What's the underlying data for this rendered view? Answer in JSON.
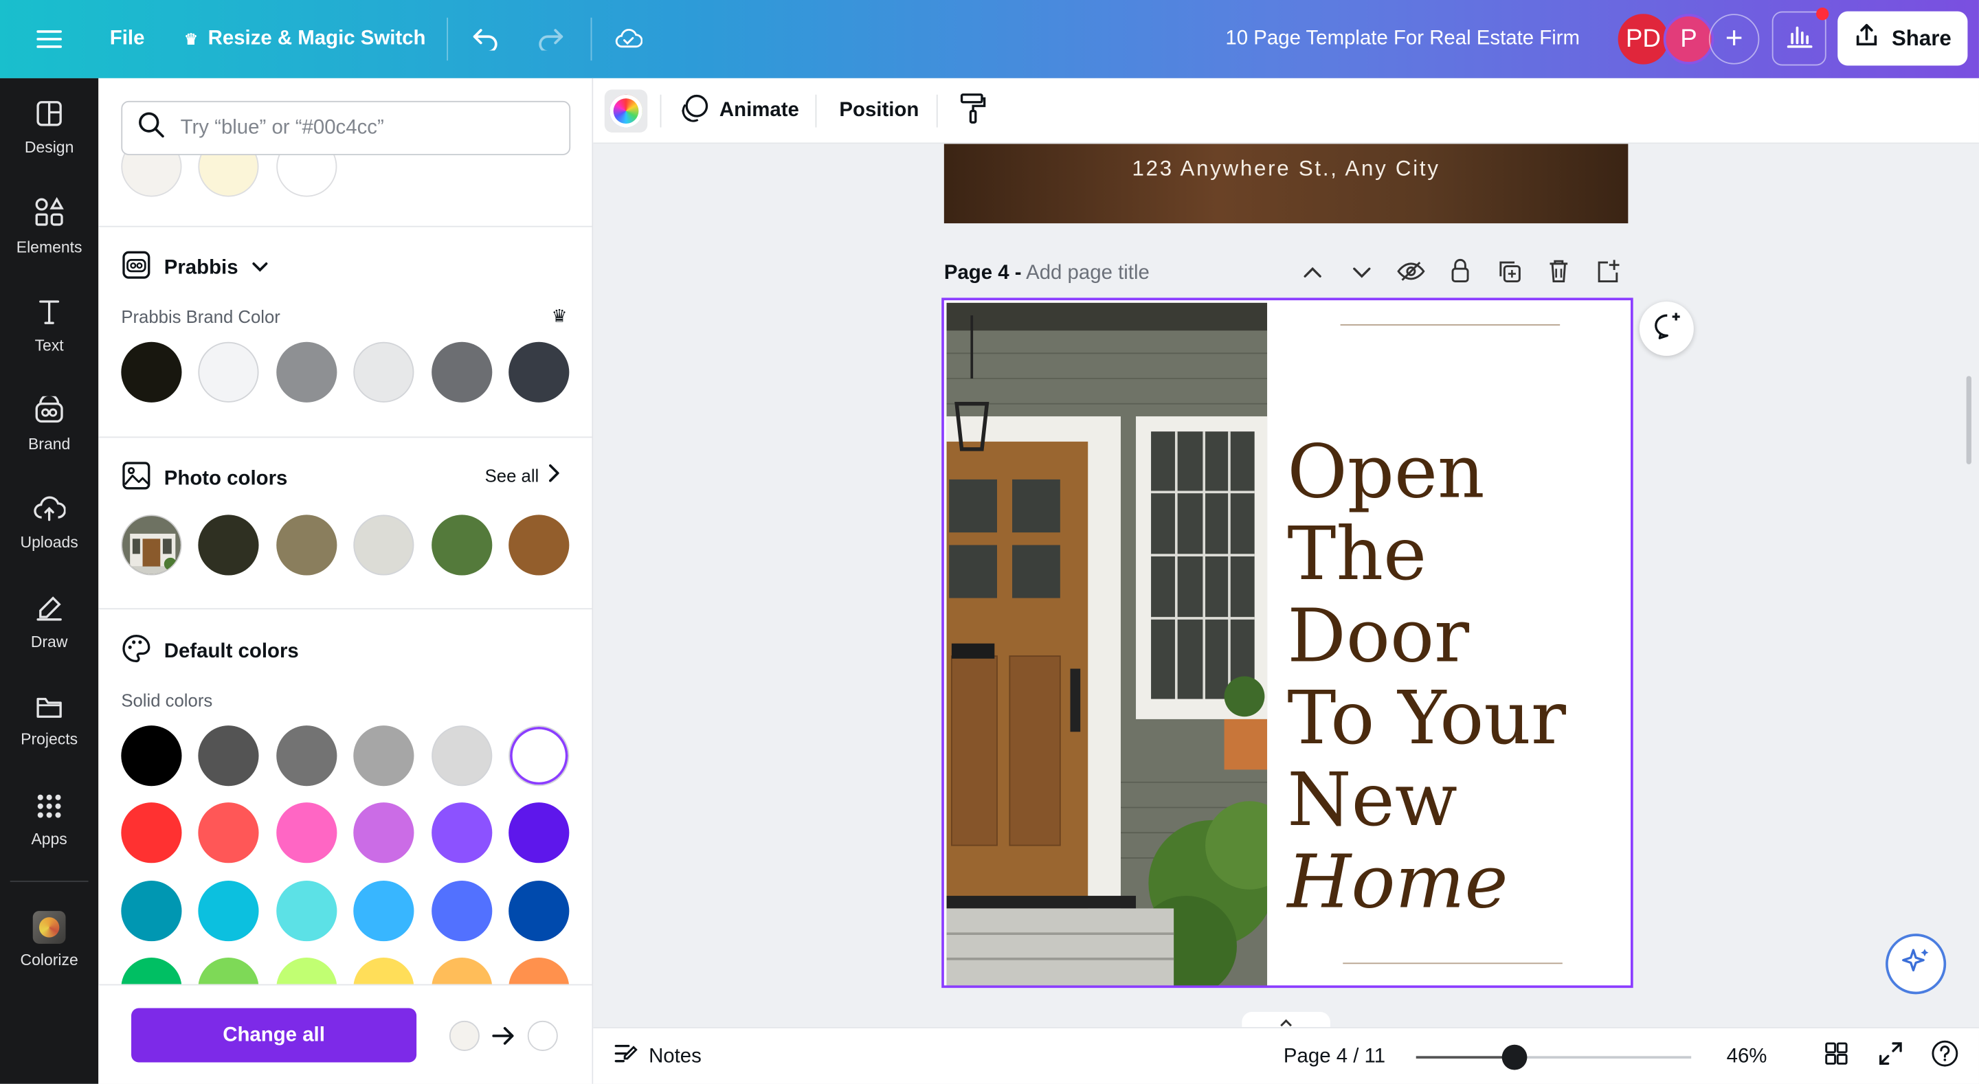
{
  "topbar": {
    "file_label": "File",
    "resize_label": "Resize & Magic Switch",
    "doc_title": "10 Page Template For Real Estate Firm",
    "avatar1": "PD",
    "avatar2": "P",
    "add_label": "+",
    "share_label": "Share"
  },
  "rail": {
    "items": [
      {
        "label": "Design"
      },
      {
        "label": "Elements"
      },
      {
        "label": "Text"
      },
      {
        "label": "Brand"
      },
      {
        "label": "Uploads"
      },
      {
        "label": "Draw"
      },
      {
        "label": "Projects"
      },
      {
        "label": "Apps"
      },
      {
        "label": "Colorize"
      }
    ]
  },
  "panel": {
    "search_placeholder": "Try “blue” or “#00c4cc”",
    "top_partial_swatches": [
      "#f4f2ee",
      "#fbf5d8",
      "#ffffff"
    ],
    "brand": {
      "name": "Prabbis",
      "sub_label": "Prabbis Brand Color",
      "swatches": [
        "#18170f",
        "#f3f4f6",
        "#8e9093",
        "#e7e8e9",
        "#6c6e72",
        "#373c45"
      ]
    },
    "photo": {
      "title": "Photo colors",
      "see_all": "See all",
      "swatches": [
        "#2f3022",
        "#8a7e5d",
        "#dcdcd6",
        "#547a3b",
        "#935e2c"
      ]
    },
    "default": {
      "title": "Default colors",
      "sub_label": "Solid colors",
      "rows": [
        [
          "#000000",
          "#545454",
          "#737373",
          "#a6a6a6",
          "#d9d9d9",
          "#ffffff"
        ],
        [
          "#ff3131",
          "#ff5757",
          "#ff66c4",
          "#cb6ce6",
          "#8c52ff",
          "#5e17eb"
        ],
        [
          "#0097b2",
          "#0cc0df",
          "#5ce1e6",
          "#38b6ff",
          "#5271ff",
          "#004aad"
        ],
        [
          "#00bf63",
          "#7ed957",
          "#c1ff72",
          "#ffde59",
          "#ffbd59",
          "#ff914d"
        ]
      ]
    },
    "footer": {
      "change_all": "Change all",
      "from_color": "#f4f2ee",
      "to_color": "#ffffff"
    }
  },
  "ctx": {
    "animate": "Animate",
    "position": "Position"
  },
  "canvas": {
    "prev_page_text": "123 Anywhere St., Any City",
    "page_label": "Page 4 -",
    "page_title_placeholder": "Add page title",
    "headline": [
      "Open",
      "The Door",
      "To Your",
      "New"
    ],
    "headline_italic": "Home",
    "accent_color": "#8b3dff"
  },
  "bottombar": {
    "notes": "Notes",
    "page_indicator": "Page 4 / 11",
    "zoom": "46%",
    "zoom_fraction": 0.46
  }
}
